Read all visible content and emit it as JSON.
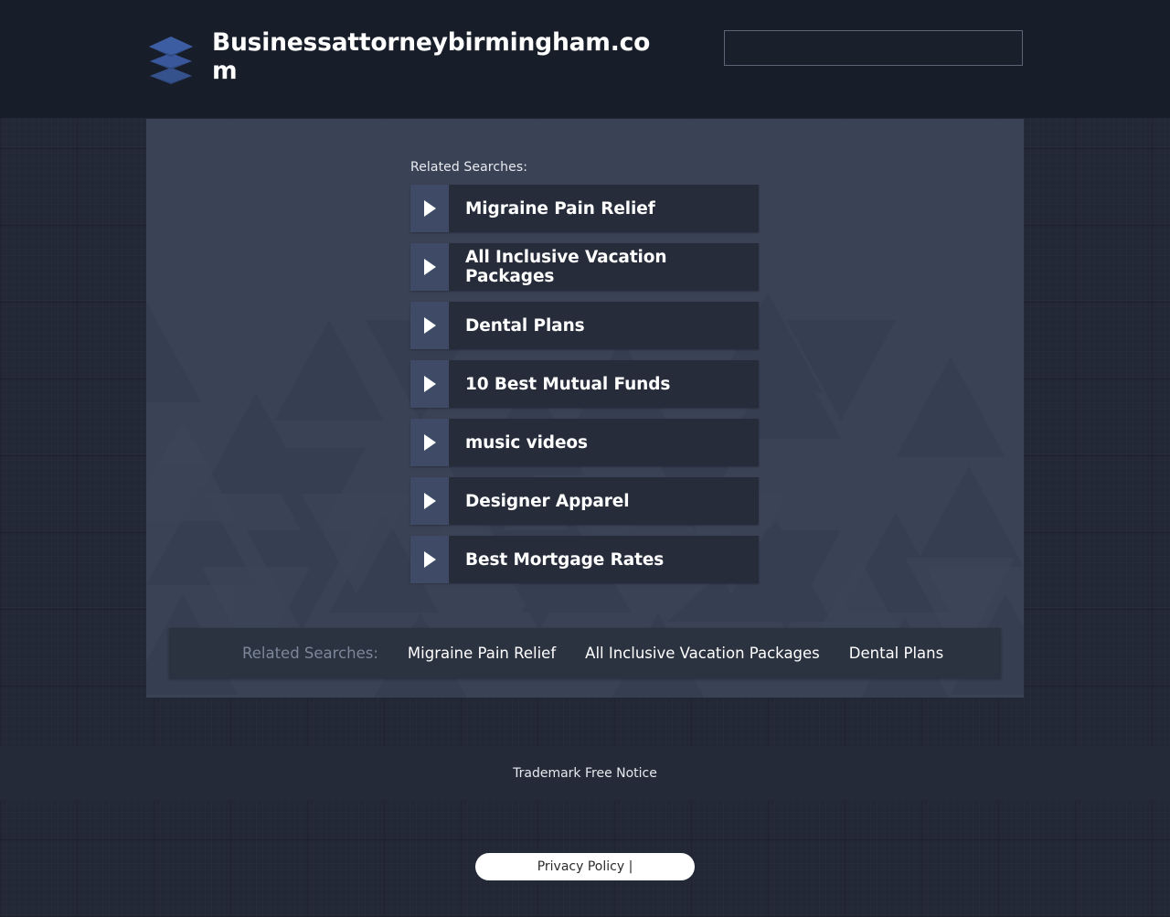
{
  "header": {
    "logo_icon": "stacked-layers-icon",
    "brand_title": "Businessattorneybirmingham.com",
    "search": {
      "value": "",
      "placeholder": ""
    },
    "background_color": "#181e29"
  },
  "main": {
    "related_label": "Related Searches:",
    "panel_color": "#3a4255",
    "item_arrow_color": "#3f4a66",
    "item_text_bg": "#262c3a",
    "items": [
      {
        "label": "Migraine Pain Relief",
        "icon": "play-triangle-icon"
      },
      {
        "label": "All Inclusive Vacation Packages",
        "icon": "play-triangle-icon"
      },
      {
        "label": "Dental Plans",
        "icon": "play-triangle-icon"
      },
      {
        "label": "10 Best Mutual Funds",
        "icon": "play-triangle-icon"
      },
      {
        "label": "music videos",
        "icon": "play-triangle-icon"
      },
      {
        "label": "Designer Apparel",
        "icon": "play-triangle-icon"
      },
      {
        "label": "Best Mortgage Rates",
        "icon": "play-triangle-icon"
      }
    ]
  },
  "related_bar": {
    "label": "Related Searches:",
    "label_color": "#7c8799",
    "links": [
      "Migraine Pain Relief",
      "All Inclusive Vacation Packages",
      "Dental Plans"
    ]
  },
  "footer": {
    "trademark_notice": "Trademark Free Notice",
    "privacy_policy": "Privacy Policy |"
  }
}
